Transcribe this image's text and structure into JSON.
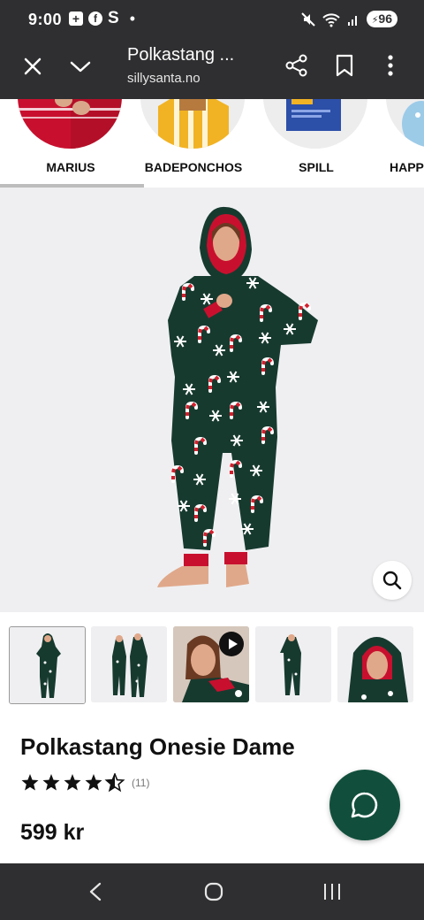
{
  "status_bar": {
    "time": "9:00",
    "left_icons": [
      "news-icon",
      "facebook-icon",
      "s-icon",
      "dot-icon"
    ],
    "right_icons": [
      "mute-icon",
      "wifi-icon",
      "signal-icon"
    ],
    "battery": "96"
  },
  "browser": {
    "title": "Polkastang ...",
    "url": "sillysanta.no",
    "icons": [
      "close-icon",
      "chevron-down-icon",
      "share-icon",
      "bookmark-icon",
      "more-vert-icon"
    ]
  },
  "categories": [
    {
      "label": "MARIUS"
    },
    {
      "label": "BADEPONCHOS"
    },
    {
      "label": "SPILL"
    },
    {
      "label": "HAPP"
    }
  ],
  "product": {
    "title": "Polkastang Onesie Dame",
    "rating": 4.5,
    "review_count": "(11)",
    "price": "599 kr"
  },
  "thumbnails": [
    {
      "type": "image",
      "selected": true
    },
    {
      "type": "image",
      "selected": false
    },
    {
      "type": "video",
      "selected": false
    },
    {
      "type": "image",
      "selected": false
    },
    {
      "type": "image",
      "selected": false
    }
  ],
  "colors": {
    "bars": "#2f2f31",
    "onesie": "#173a2f",
    "accent_red": "#c8102e",
    "chat_button": "#114f3c",
    "image_bg": "#efeff1"
  }
}
